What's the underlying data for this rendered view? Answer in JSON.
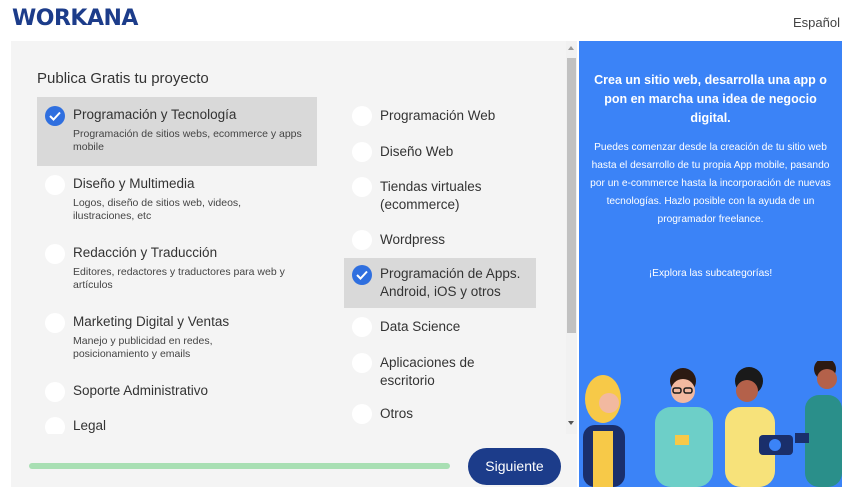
{
  "header": {
    "logo": "WORKANA",
    "language": "Español"
  },
  "form": {
    "title": "Publica Gratis tu proyecto",
    "left_options": [
      {
        "label": "Programación y Tecnología",
        "desc": "Programación de sitios webs, ecommerce y apps mobile",
        "selected": true
      },
      {
        "label": "Diseño y Multimedia",
        "desc": "Logos, diseño de sitios web, videos, ilustraciones, etc",
        "selected": false
      },
      {
        "label": "Redacción y Traducción",
        "desc": "Editores, redactores y traductores para web y artículos",
        "selected": false
      },
      {
        "label": "Marketing Digital y Ventas",
        "desc": "Manejo y publicidad en redes, posicionamiento y emails",
        "selected": false
      },
      {
        "label": "Soporte Administrativo",
        "desc": "",
        "selected": false
      },
      {
        "label": "Legal",
        "desc": "",
        "selected": false
      }
    ],
    "right_options": [
      {
        "label": "Programación Web",
        "selected": false
      },
      {
        "label": "Diseño Web",
        "selected": false
      },
      {
        "label": "Tiendas virtuales (ecommerce)",
        "selected": false
      },
      {
        "label": "Wordpress",
        "selected": false
      },
      {
        "label": "Programación de Apps. Android, iOS y otros",
        "selected": true
      },
      {
        "label": "Data Science",
        "selected": false
      },
      {
        "label": "Aplicaciones de escritorio",
        "selected": false
      },
      {
        "label": "Otros",
        "selected": false
      }
    ],
    "next_button": "Siguiente"
  },
  "promo": {
    "title": "Crea un sitio web, desarrolla una app o pon en marcha una idea de negocio digital.",
    "body": "Puedes comenzar desde la creación de tu sitio web hasta el desarrollo de tu propia App mobile, pasando por un e-commerce hasta la incorporación de nuevas tecnologías. Hazlo posible con la ayuda de un programador freelance.",
    "link": "¡Explora las subcategorías!"
  },
  "colors": {
    "brand": "#1c3c8a",
    "accent": "#2f6fdf",
    "panel": "#3b83f7",
    "progress": "#a8dfb3"
  }
}
